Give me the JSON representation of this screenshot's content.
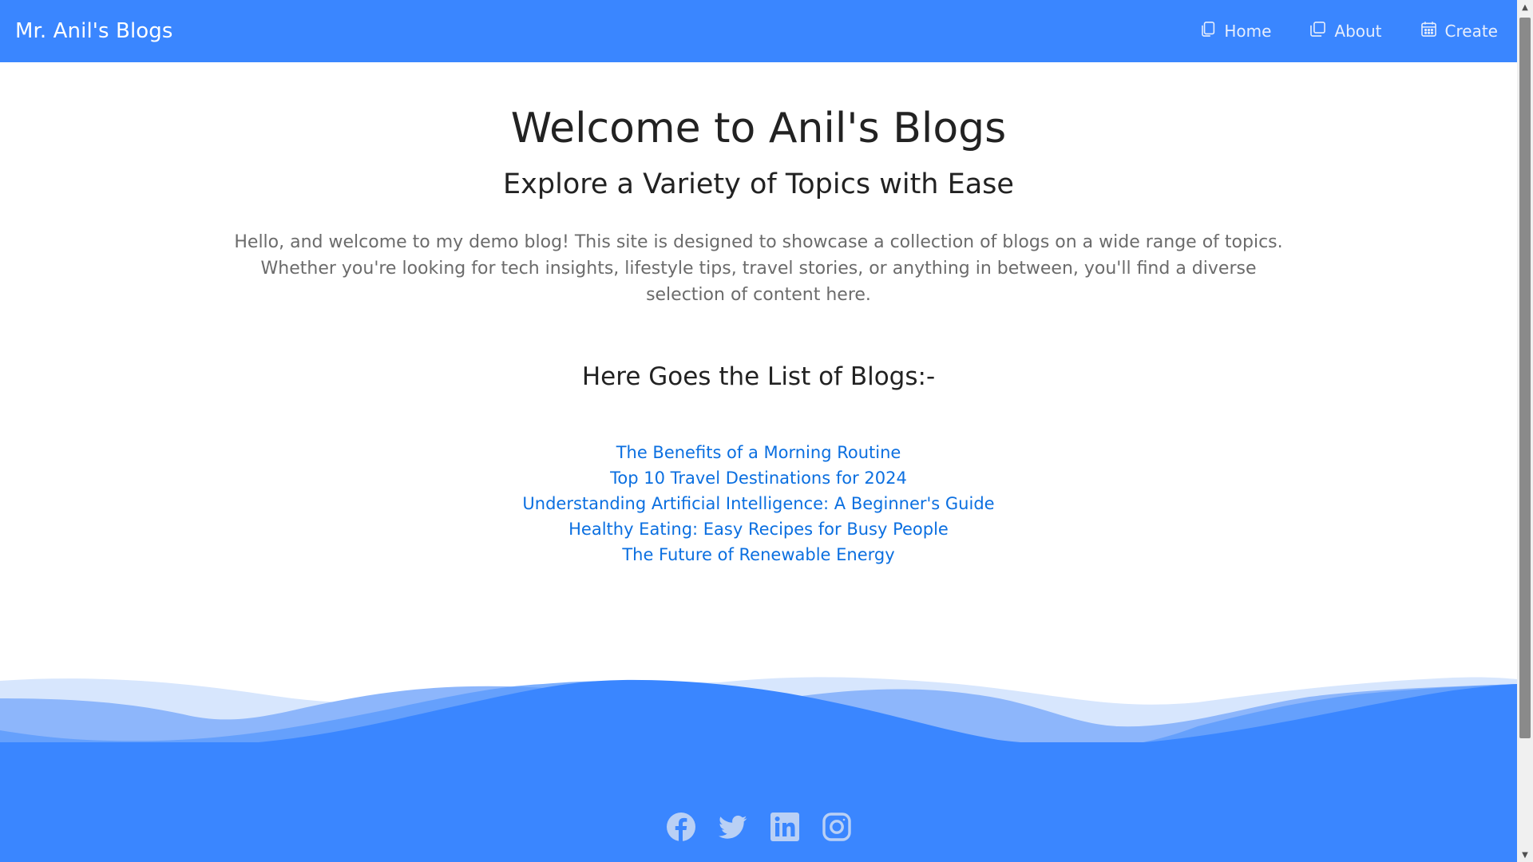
{
  "header": {
    "brand": "Mr. Anil's Blogs",
    "nav": [
      {
        "label": "Home",
        "icon": "copy-icon"
      },
      {
        "label": "About",
        "icon": "window-stack-icon"
      },
      {
        "label": "Create",
        "icon": "calendar-icon"
      }
    ]
  },
  "hero": {
    "title": "Welcome to Anil's Blogs",
    "subtitle": "Explore a Variety of Topics with Ease",
    "intro": "Hello, and welcome to my demo blog! This site is designed to showcase a collection of blogs on a wide range of topics. Whether you're looking for tech insights, lifestyle tips, travel stories, or anything in between, you'll find a diverse selection of content here."
  },
  "blogs": {
    "heading": "Here Goes the List of Blogs:-",
    "items": [
      "The Benefits of a Morning Routine",
      "Top 10 Travel Destinations for 2024",
      "Understanding Artificial Intelligence: A Beginner's Guide",
      "Healthy Eating: Easy Recipes for Busy People",
      "The Future of Renewable Energy"
    ]
  },
  "footer": {
    "socials": [
      "facebook-icon",
      "twitter-icon",
      "linkedin-icon",
      "instagram-icon"
    ]
  },
  "colors": {
    "primary": "#3a86ff",
    "link": "#0b6fe0",
    "heading": "#222222",
    "body_text": "#6b6b6b",
    "nav_text": "#e7eefc",
    "social_icon": "#b9d0f5"
  }
}
